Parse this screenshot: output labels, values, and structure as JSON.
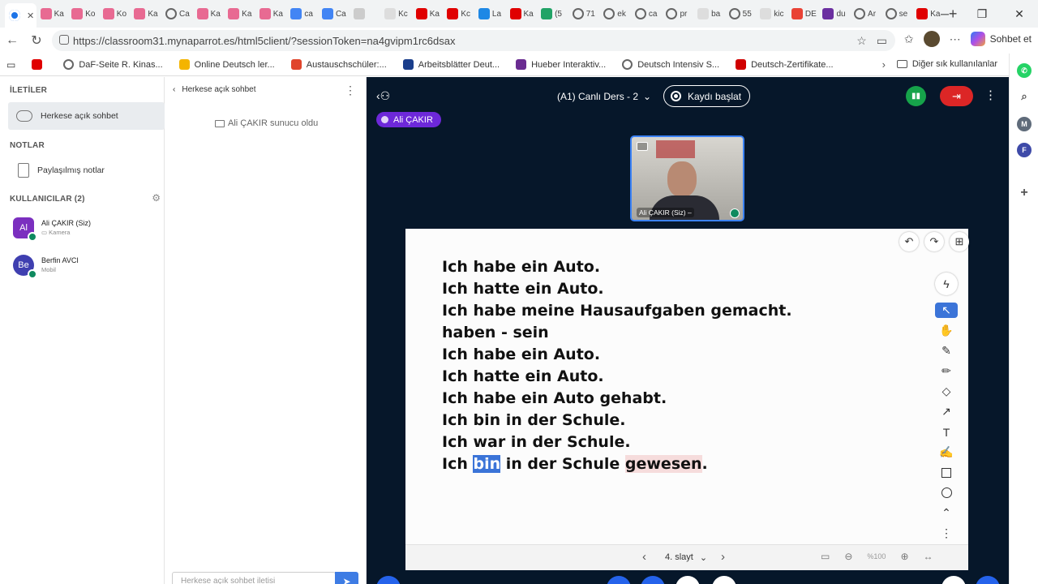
{
  "browser": {
    "tabs": [
      {
        "label": "",
        "fav": "target",
        "active": true
      },
      {
        "label": "Ka",
        "fav": "#e86a92"
      },
      {
        "label": "Ko",
        "fav": "#e86a92"
      },
      {
        "label": "Ko",
        "fav": "#e86a92"
      },
      {
        "label": "Ka",
        "fav": "#e86a92"
      },
      {
        "label": "Ca",
        "fav": "ring"
      },
      {
        "label": "Ka",
        "fav": "#e86a92"
      },
      {
        "label": "Ka",
        "fav": "#e86a92"
      },
      {
        "label": "Ka",
        "fav": "#e86a92"
      },
      {
        "label": "ca",
        "fav": "#4285f4"
      },
      {
        "label": "Ca",
        "fav": "#4285f4"
      },
      {
        "label": "",
        "fav": "#cccccc"
      },
      {
        "label": "Kc",
        "fav": "#dddddd"
      },
      {
        "label": "Ka",
        "fav": "#e00000"
      },
      {
        "label": "Kc",
        "fav": "#e00000"
      },
      {
        "label": "La",
        "fav": "#1e88e5"
      },
      {
        "label": "Ka",
        "fav": "#e00000"
      },
      {
        "label": "(5",
        "fav": "#21a366"
      },
      {
        "label": "71",
        "fav": "ring"
      },
      {
        "label": "ek",
        "fav": "ring"
      },
      {
        "label": "ca",
        "fav": "ring"
      },
      {
        "label": "pr",
        "fav": "ring"
      },
      {
        "label": "ba",
        "fav": "#dddddd"
      },
      {
        "label": "55",
        "fav": "ring"
      },
      {
        "label": "kic",
        "fav": "#dddddd"
      },
      {
        "label": "DE",
        "fav": "#e94235"
      },
      {
        "label": "du",
        "fav": "#6b2fa0"
      },
      {
        "label": "Ar",
        "fav": "ring"
      },
      {
        "label": "se",
        "fav": "ring"
      },
      {
        "label": "Ka",
        "fav": "#e00000"
      }
    ],
    "url": "https://classroom31.mynaparrot.es/html5client/?sessionToken=na4gvipm1rc6dsax",
    "copilot_label": "Sohbet et",
    "bookmarks": [
      {
        "label": "",
        "fav": "#e00000"
      },
      {
        "label": "DaF-Seite R. Kinas...",
        "fav": "ring"
      },
      {
        "label": "Online Deutsch ler...",
        "fav": "#f4b400"
      },
      {
        "label": "Austauschschüler:...",
        "fav": "#e0452c"
      },
      {
        "label": "Arbeitsblätter Deut...",
        "fav": "#1a3e8c"
      },
      {
        "label": "Hueber Interaktiv...",
        "fav": "#6a2c91"
      },
      {
        "label": "Deutsch Intensiv S...",
        "fav": "ring"
      },
      {
        "label": "Deutsch-Zertifikate...",
        "fav": "#d00000"
      }
    ],
    "other_bookmarks": "Diğer sık kullanılanlar"
  },
  "sidebar": {
    "messages_header": "İLETİLER",
    "public_chat": "Herkese açık sohbet",
    "notes_header": "NOTLAR",
    "shared_notes": "Paylaşılmış notlar",
    "users_header": "KULLANICILAR (2)",
    "users": [
      {
        "initials": "Al",
        "name": "Ali ÇAKIR (Siz)",
        "sub": "Kamera",
        "color": "#7b2fbf"
      },
      {
        "initials": "Be",
        "name": "Berfin AVCI",
        "sub": "Mobil",
        "color": "#3f3fb0"
      }
    ]
  },
  "chat": {
    "title": "Herkese açık sohbet",
    "system_message": "Ali ÇAKIR sunucu oldu",
    "input_placeholder": "Herkese açık sohbet iletisi"
  },
  "meeting": {
    "title": "(A1) Canlı Ders - 2",
    "record_label": "Kaydı başlat",
    "talker": "Ali ÇAKIR",
    "camera_name": "Ali ÇAKIR (Siz) –",
    "slide_label": "4. slayt",
    "zoom": "%100"
  },
  "slide": {
    "lines": [
      "Ich habe ein Auto.",
      "Ich hatte ein Auto.",
      "Ich habe meine Hausaufgaben gemacht.",
      "haben - sein",
      "Ich habe ein Auto.",
      "Ich hatte ein Auto.",
      "Ich habe ein Auto gehabt.",
      "Ich bin in der Schule.",
      "Ich war in der Schule."
    ],
    "last_line": {
      "before": "Ich ",
      "highlight": "bin",
      "middle": " in der Schule ",
      "pink": "gewesen",
      "after": "."
    }
  },
  "colors": {
    "meeting_bg": "#06172a",
    "accent_blue": "#3b74d8",
    "leave_red": "#dc2626",
    "signal_green": "#16a34a",
    "talker_purple": "#6d28d9"
  }
}
